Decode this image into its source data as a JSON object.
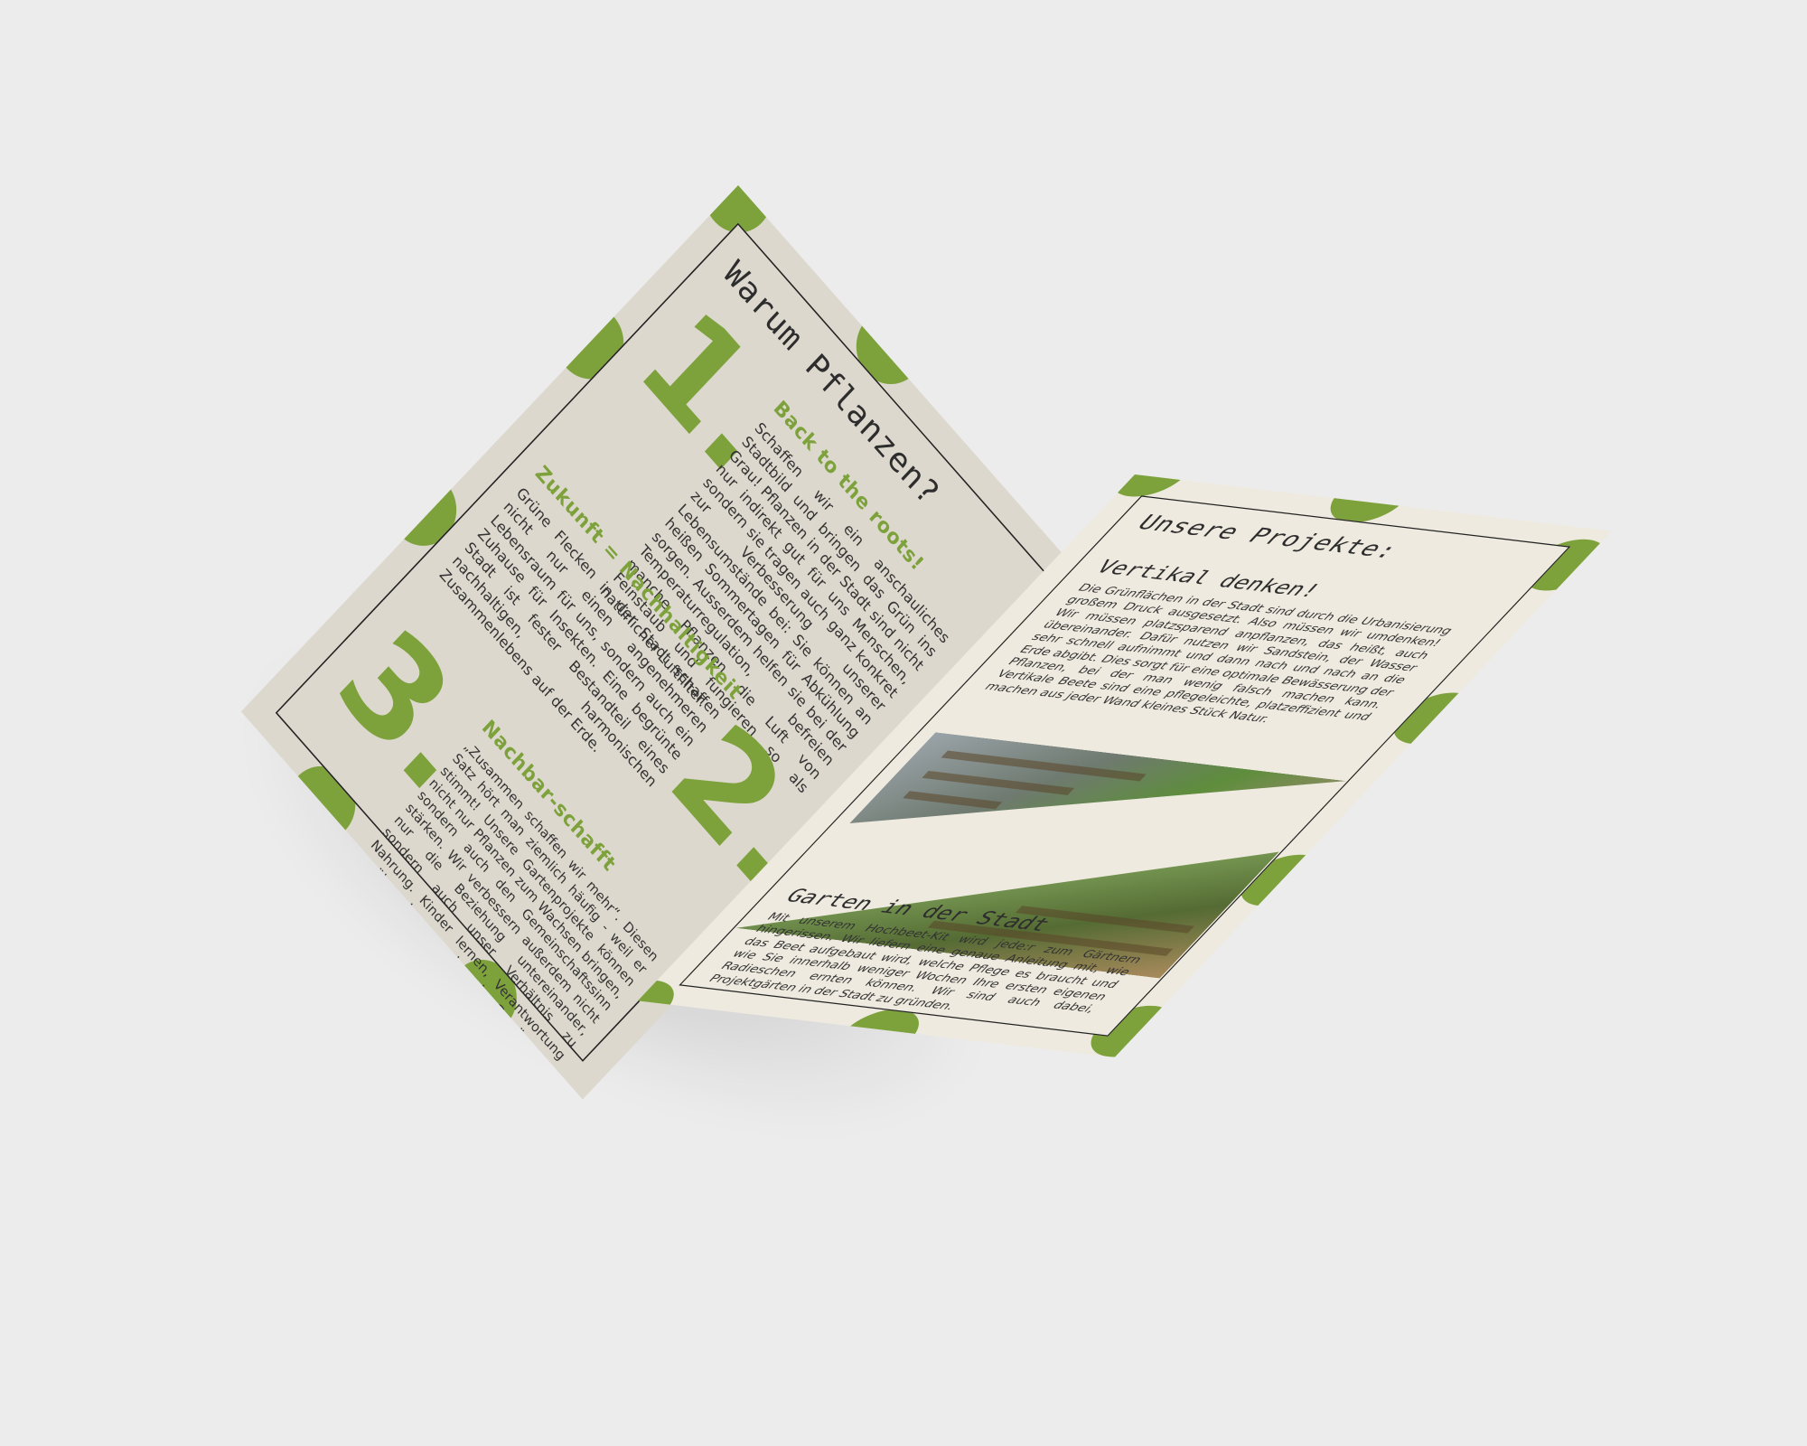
{
  "colors": {
    "accent": "#7da23c",
    "paper": "#ede8dd",
    "text": "#333333",
    "background": "#ececec"
  },
  "left_page": {
    "title": "Warum Pflanzen?",
    "items": [
      {
        "number": "1.",
        "heading": "Back to the roots!",
        "text": "Schaffen wir ein anschauliches Stadtbild und bringen das Grün ins Grau! Pflanzen in der Stadt sind nicht nur indirekt gut für uns Menschen, sondern sie tragen auch ganz konkret zur Verbesserung unserer Lebensumstände bei: Sie können an heißen Sommertagen für Abkühlung sorgen. Ausserdem helfen sie bei der Temperaturregulation, befreien manche Pflanzen die Luft von Feinstaub und fungieren so als natürlicher Luftfilter."
      },
      {
        "number": "2.",
        "heading": "Zukunft = Nachhaltigkeit",
        "text": "Grüne Flecken in der Stadt schaffen nicht nur einen angenehmeren Lebensraum für uns, sondern auch ein Zuhause für Insekten. Eine begrünte Stadt ist fester Bestandteil eines nachhaltigen, harmonischen Zusammenlebens auf der Erde."
      },
      {
        "number": "3.",
        "heading": "Nachbar-schafft",
        "text": "„Zusammen schaffen wir mehr“. Diesen Satz hört man ziemlich häufig - weil er stimmt! Unsere Gartenprojekte können nicht nur Pflanzen zum Wachsen bringen, sondern auch den Gemeinschaftssinn stärken. Wir verbessern außerdem nicht nur die Beziehung untereinander, sondern auch unser Verhältnis zu Nahrung. Kinder lernen, Verantwortung zu übernehmen, und wo das Gemüse aus dem Supermarkt eigentlich herkommt."
      }
    ]
  },
  "right_page": {
    "title": "Unsere Projekte:",
    "section1": {
      "heading": "Vertikal denken!",
      "text": "Die Grünflächen in der Stadt sind durch die Urbanisierung großem Druck ausgesetzt. Also müssen wir umdenken! Wir müssen platzsparend anpflanzen, das heißt, auch übereinander. Dafür nutzen wir Sandstein, der Wasser sehr schnell aufnimmt und dann nach und nach an die Erde abgibt. Dies sorgt für eine optimale Bewässerung der Pflanzen, bei der man wenig falsch machen kann. Vertikale Beete sind eine pflegeleichte, platzeffizient und machen aus jeder Wand kleines Stück Natur."
    },
    "section2": {
      "heading": "Garten in der Stadt",
      "text": "Mit unserem Hochbeet-Kit wird jede:r zum Gärtnern hingerissen. Wir liefern eine genaue Anleitung mit, wie das Beet aufgebaut wird, welche Pflege es braucht und wie Sie innerhalb weniger Wochen Ihre ersten eigenen Radieschen ernten können. Wir sind auch dabei, Projektgärten in der Stadt zu gründen."
    }
  }
}
